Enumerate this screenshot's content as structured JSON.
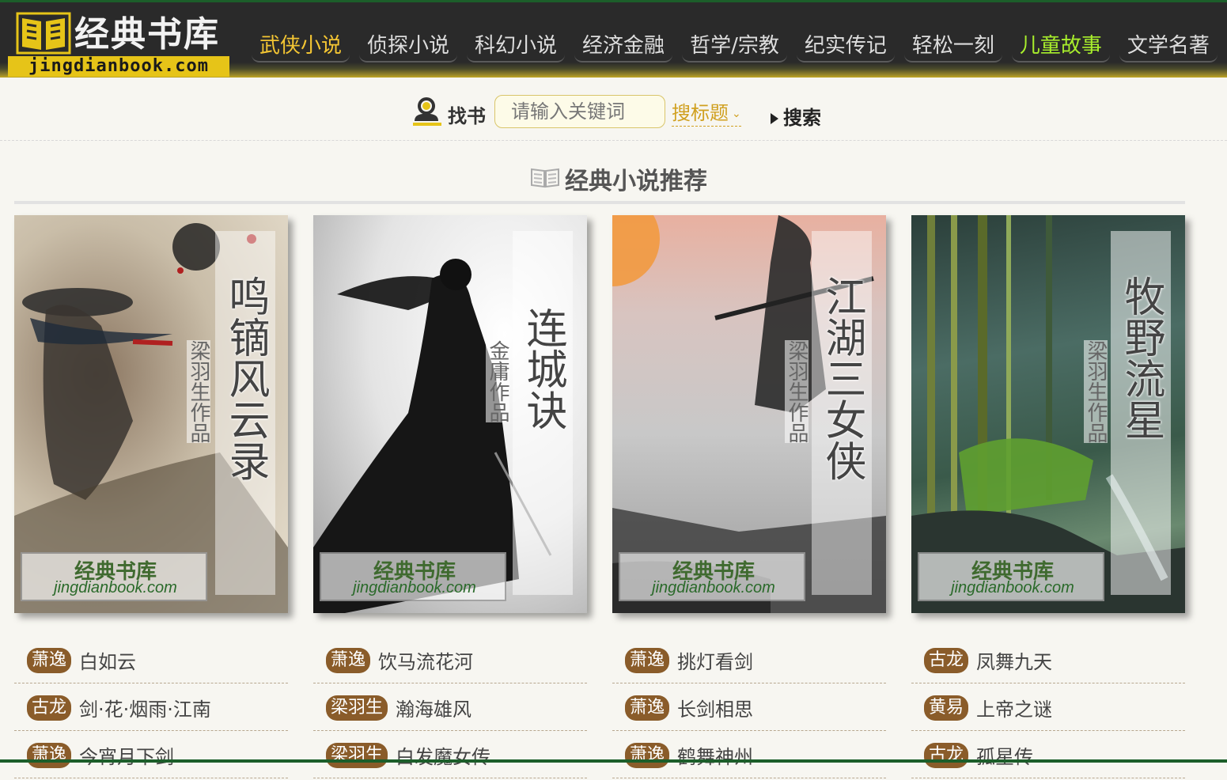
{
  "logo": {
    "title": "经典书库",
    "url": "jingdianbook.com"
  },
  "nav": [
    {
      "label": "武侠小说",
      "style": "gold"
    },
    {
      "label": "侦探小说",
      "style": "normal"
    },
    {
      "label": "科幻小说",
      "style": "normal"
    },
    {
      "label": "经济金融",
      "style": "normal"
    },
    {
      "label": "哲学/宗教",
      "style": "normal"
    },
    {
      "label": "纪实传记",
      "style": "normal"
    },
    {
      "label": "轻松一刻",
      "style": "normal"
    },
    {
      "label": "儿童故事",
      "style": "green"
    },
    {
      "label": "文学名著",
      "style": "normal"
    }
  ],
  "search": {
    "label": "找书",
    "placeholder": "请输入关键词",
    "type": "搜标题",
    "button": "搜索"
  },
  "section": {
    "title": "经典小说推荐"
  },
  "covers": [
    {
      "title": "鸣镝风云录",
      "author": "梁羽生作品",
      "wm_title": "经典书库",
      "wm_url": "jingdianbook.com"
    },
    {
      "title": "连城诀",
      "author": "金庸作品",
      "wm_title": "经典书库",
      "wm_url": "jingdianbook.com"
    },
    {
      "title": "江湖三女侠",
      "author": "梁羽生作品",
      "wm_title": "经典书库",
      "wm_url": "jingdianbook.com"
    },
    {
      "title": "牧野流星",
      "author": "梁羽生作品",
      "wm_title": "经典书库",
      "wm_url": "jingdianbook.com"
    }
  ],
  "lists": [
    [
      {
        "author": "萧逸",
        "book": "白如云"
      },
      {
        "author": "古龙",
        "book": "剑·花·烟雨·江南"
      },
      {
        "author": "萧逸",
        "book": "今宵月下剑"
      }
    ],
    [
      {
        "author": "萧逸",
        "book": "饮马流花河"
      },
      {
        "author": "梁羽生",
        "book": "瀚海雄风"
      },
      {
        "author": "梁羽生",
        "book": "白发魔女传"
      }
    ],
    [
      {
        "author": "萧逸",
        "book": "挑灯看剑"
      },
      {
        "author": "萧逸",
        "book": "长剑相思"
      },
      {
        "author": "萧逸",
        "book": "鹤舞神州"
      }
    ],
    [
      {
        "author": "古龙",
        "book": "凤舞九天"
      },
      {
        "author": "黄易",
        "book": "上帝之谜"
      },
      {
        "author": "古龙",
        "book": "孤星传"
      }
    ]
  ],
  "colors": {
    "header_bg": "#2a2a2a",
    "accent_gold": "#e6c418",
    "badge": "#8a5c2a",
    "nav_green": "#a8ee2c"
  }
}
